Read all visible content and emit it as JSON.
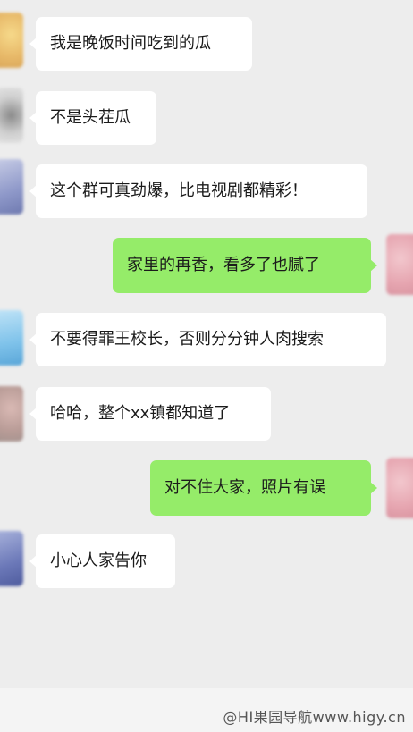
{
  "messages": [
    {
      "side": "in",
      "text": "我是晚饭时间吃到的瓜"
    },
    {
      "side": "in",
      "text": "不是头茬瓜"
    },
    {
      "side": "in",
      "text": "这个群可真劲爆，比电视剧都精彩！"
    },
    {
      "side": "out",
      "text": "家里的再香，看多了也腻了"
    },
    {
      "side": "in",
      "text": "不要得罪王校长，否则分分钟人肉搜索"
    },
    {
      "side": "in",
      "text": "哈哈，整个xx镇都知道了"
    },
    {
      "side": "out",
      "text": "对不住大家，照片有误"
    },
    {
      "side": "in",
      "text": "小心人家告你"
    }
  ],
  "watermark": "@HI果园导航www.higy.cn",
  "colors": {
    "background": "#ededed",
    "incoming_bubble": "#ffffff",
    "outgoing_bubble": "#95ec69"
  }
}
